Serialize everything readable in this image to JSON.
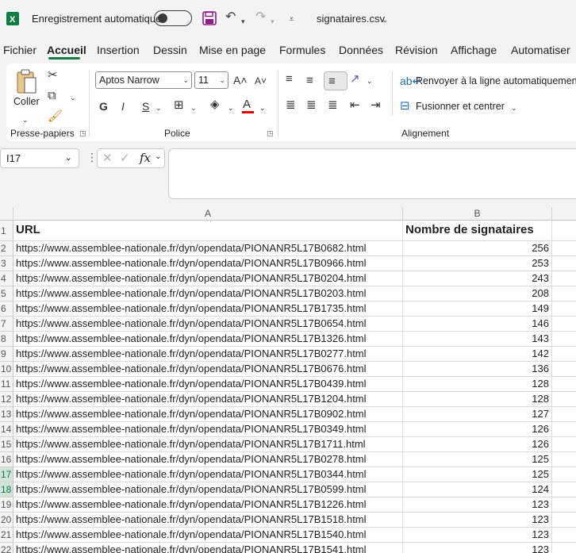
{
  "titlebar": {
    "autosave_label": "Enregistrement automatique",
    "filename": "signataires.csv"
  },
  "menu": {
    "tabs": [
      {
        "label": "Fichier",
        "active": false
      },
      {
        "label": "Accueil",
        "active": true
      },
      {
        "label": "Insertion",
        "active": false
      },
      {
        "label": "Dessin",
        "active": false
      },
      {
        "label": "Mise en page",
        "active": false
      },
      {
        "label": "Formules",
        "active": false
      },
      {
        "label": "Données",
        "active": false
      },
      {
        "label": "Révision",
        "active": false
      },
      {
        "label": "Affichage",
        "active": false
      },
      {
        "label": "Automatiser",
        "active": false
      }
    ]
  },
  "ribbon": {
    "clipboard": {
      "paste_label": "Coller",
      "group_label": "Presse-papiers"
    },
    "font": {
      "group_label": "Police",
      "font_name": "Aptos Narrow",
      "font_size": "11",
      "bold": "G",
      "italic": "I",
      "underline": "S",
      "font_color": "A",
      "font_color_hex": "#e00000"
    },
    "alignment": {
      "group_label": "Alignement",
      "wrap_label": "Renvoyer à la ligne automatiquement",
      "merge_label": "Fusionner et centrer"
    }
  },
  "formula_bar": {
    "cell_ref": "I17",
    "fx_label": "fx",
    "formula": ""
  },
  "accent_color": "#107c41",
  "sheet": {
    "columns": [
      "A",
      "B"
    ],
    "header": {
      "url": "URL",
      "count": "Nombre de signataires"
    },
    "selected_rows": [
      17,
      18
    ],
    "rows": [
      {
        "n": "2",
        "url": "https://www.assemblee-nationale.fr/dyn/opendata/PIONANR5L17B0682.html",
        "count": "256"
      },
      {
        "n": "3",
        "url": "https://www.assemblee-nationale.fr/dyn/opendata/PIONANR5L17B0966.html",
        "count": "253"
      },
      {
        "n": "4",
        "url": "https://www.assemblee-nationale.fr/dyn/opendata/PIONANR5L17B0204.html",
        "count": "243"
      },
      {
        "n": "5",
        "url": "https://www.assemblee-nationale.fr/dyn/opendata/PIONANR5L17B0203.html",
        "count": "208"
      },
      {
        "n": "6",
        "url": "https://www.assemblee-nationale.fr/dyn/opendata/PIONANR5L17B1735.html",
        "count": "149"
      },
      {
        "n": "7",
        "url": "https://www.assemblee-nationale.fr/dyn/opendata/PIONANR5L17B0654.html",
        "count": "146"
      },
      {
        "n": "8",
        "url": "https://www.assemblee-nationale.fr/dyn/opendata/PIONANR5L17B1326.html",
        "count": "143"
      },
      {
        "n": "9",
        "url": "https://www.assemblee-nationale.fr/dyn/opendata/PIONANR5L17B0277.html",
        "count": "142"
      },
      {
        "n": "10",
        "url": "https://www.assemblee-nationale.fr/dyn/opendata/PIONANR5L17B0676.html",
        "count": "136"
      },
      {
        "n": "11",
        "url": "https://www.assemblee-nationale.fr/dyn/opendata/PIONANR5L17B0439.html",
        "count": "128"
      },
      {
        "n": "12",
        "url": "https://www.assemblee-nationale.fr/dyn/opendata/PIONANR5L17B1204.html",
        "count": "128"
      },
      {
        "n": "13",
        "url": "https://www.assemblee-nationale.fr/dyn/opendata/PIONANR5L17B0902.html",
        "count": "127"
      },
      {
        "n": "14",
        "url": "https://www.assemblee-nationale.fr/dyn/opendata/PIONANR5L17B0349.html",
        "count": "126"
      },
      {
        "n": "15",
        "url": "https://www.assemblee-nationale.fr/dyn/opendata/PIONANR5L17B1711.html",
        "count": "126"
      },
      {
        "n": "16",
        "url": "https://www.assemblee-nationale.fr/dyn/opendata/PIONANR5L17B0278.html",
        "count": "125"
      },
      {
        "n": "17",
        "url": "https://www.assemblee-nationale.fr/dyn/opendata/PIONANR5L17B0344.html",
        "count": "125"
      },
      {
        "n": "18",
        "url": "https://www.assemblee-nationale.fr/dyn/opendata/PIONANR5L17B0599.html",
        "count": "124"
      },
      {
        "n": "19",
        "url": "https://www.assemblee-nationale.fr/dyn/opendata/PIONANR5L17B1226.html",
        "count": "123"
      },
      {
        "n": "20",
        "url": "https://www.assemblee-nationale.fr/dyn/opendata/PIONANR5L17B1518.html",
        "count": "123"
      },
      {
        "n": "21",
        "url": "https://www.assemblee-nationale.fr/dyn/opendata/PIONANR5L17B1540.html",
        "count": "123"
      },
      {
        "n": "22",
        "url": "https://www.assemblee-nationale.fr/dyn/opendata/PIONANR5L17B1541.html",
        "count": "123"
      }
    ]
  }
}
